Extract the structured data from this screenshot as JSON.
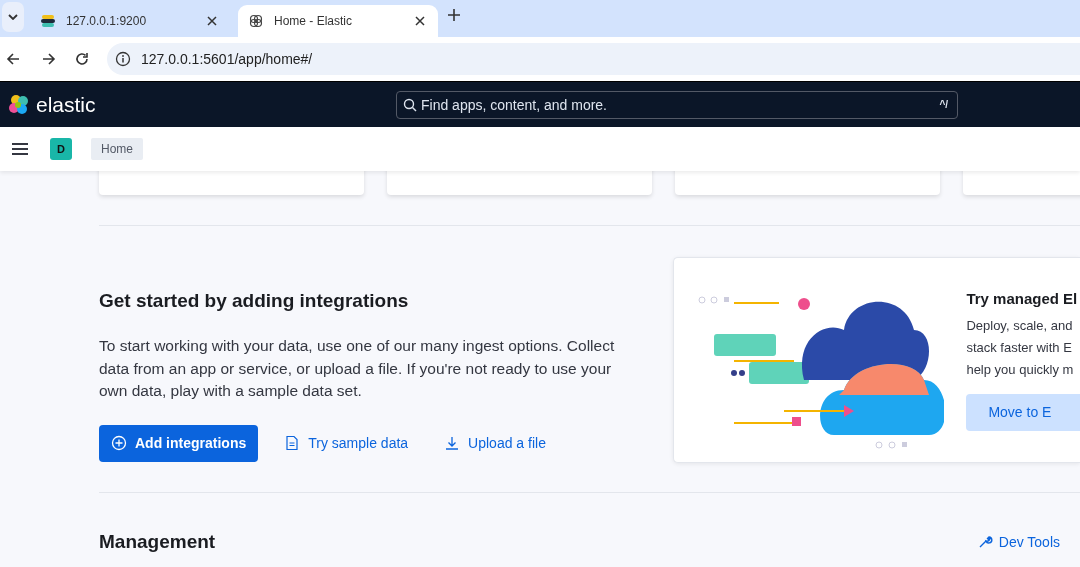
{
  "browser": {
    "tabs": [
      {
        "title": "127.0.0.1:9200",
        "kind": "elastic",
        "selected": false
      },
      {
        "title": "Home - Elastic",
        "kind": "globe",
        "selected": true
      }
    ],
    "url": "127.0.0.1:5601/app/home#/"
  },
  "header": {
    "brand": "elastic",
    "search": {
      "placeholder": "Find apps, content, and more.",
      "shortcut": "^/"
    }
  },
  "nav": {
    "avatar": "D",
    "breadcrumbs": [
      {
        "label": "Home"
      }
    ]
  },
  "integrations": {
    "title": "Get started by adding integrations",
    "description": "To start working with your data, use one of our many ingest options. Collect data from an app or service, or upload a file. If you're not ready to use your own data, play with a sample data set.",
    "actions": [
      {
        "label": "Add integrations",
        "kind": "primary"
      },
      {
        "label": "Try sample data",
        "kind": "sample"
      },
      {
        "label": "Upload a file",
        "kind": "upload"
      }
    ]
  },
  "cloud_promo": {
    "title": "Try managed El",
    "description": "Deploy, scale, and\nstack faster with E\nhelp you quickly m",
    "button": "Move to E"
  },
  "management": {
    "title": "Management",
    "links": [
      {
        "label": "Dev Tools"
      }
    ]
  }
}
